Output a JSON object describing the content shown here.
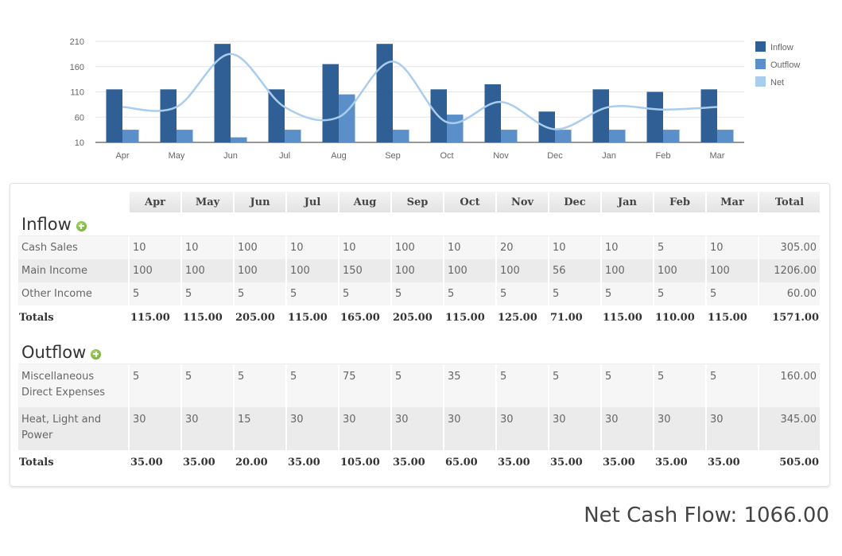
{
  "chart_data": {
    "type": "bar",
    "title": "",
    "xlabel": "",
    "ylabel": "",
    "categories": [
      "Apr",
      "May",
      "Jun",
      "Jul",
      "Aug",
      "Sep",
      "Oct",
      "Nov",
      "Dec",
      "Jan",
      "Feb",
      "Mar"
    ],
    "series": [
      {
        "name": "Inflow",
        "kind": "bar",
        "color": "#2f5f94",
        "values": [
          115,
          115,
          205,
          115,
          165,
          205,
          115,
          125,
          71,
          115,
          110,
          115
        ]
      },
      {
        "name": "Outflow",
        "kind": "bar",
        "color": "#5b8fc9",
        "values": [
          35,
          35,
          20,
          35,
          105,
          35,
          65,
          35,
          35,
          35,
          35,
          35
        ]
      },
      {
        "name": "Net",
        "kind": "line",
        "color": "#a9cdee",
        "values": [
          80,
          80,
          185,
          80,
          60,
          170,
          50,
          90,
          36,
          80,
          75,
          80
        ]
      }
    ],
    "yticks": [
      10,
      60,
      110,
      160,
      210
    ],
    "ylim": [
      10,
      210
    ],
    "grid": true,
    "legend": "top-right"
  },
  "table": {
    "months": [
      "Apr",
      "May",
      "Jun",
      "Jul",
      "Aug",
      "Sep",
      "Oct",
      "Nov",
      "Dec",
      "Jan",
      "Feb",
      "Mar"
    ],
    "total_header": "Total",
    "inflow": {
      "title": "Inflow",
      "add_icon": "plus-circle-icon",
      "rows": [
        {
          "label": "Cash Sales",
          "values": [
            "10",
            "10",
            "100",
            "10",
            "10",
            "100",
            "10",
            "20",
            "10",
            "10",
            "5",
            "10"
          ],
          "total": "305.00"
        },
        {
          "label": "Main Income",
          "values": [
            "100",
            "100",
            "100",
            "100",
            "150",
            "100",
            "100",
            "100",
            "56",
            "100",
            "100",
            "100"
          ],
          "total": "1206.00"
        },
        {
          "label": "Other Income",
          "values": [
            "5",
            "5",
            "5",
            "5",
            "5",
            "5",
            "5",
            "5",
            "5",
            "5",
            "5",
            "5"
          ],
          "total": "60.00"
        }
      ],
      "totals_label": "Totals",
      "totals": [
        "115.00",
        "115.00",
        "205.00",
        "115.00",
        "165.00",
        "205.00",
        "115.00",
        "125.00",
        "71.00",
        "115.00",
        "110.00",
        "115.00"
      ],
      "grand_total": "1571.00"
    },
    "outflow": {
      "title": "Outflow",
      "add_icon": "plus-circle-icon",
      "rows": [
        {
          "label": "Miscellaneous Direct Expenses",
          "values": [
            "5",
            "5",
            "5",
            "5",
            "75",
            "5",
            "35",
            "5",
            "5",
            "5",
            "5",
            "5"
          ],
          "total": "160.00"
        },
        {
          "label": "Heat, Light and Power",
          "values": [
            "30",
            "30",
            "15",
            "30",
            "30",
            "30",
            "30",
            "30",
            "30",
            "30",
            "30",
            "30"
          ],
          "total": "345.00"
        }
      ],
      "totals_label": "Totals",
      "totals": [
        "35.00",
        "35.00",
        "20.00",
        "35.00",
        "105.00",
        "35.00",
        "65.00",
        "35.00",
        "35.00",
        "35.00",
        "35.00",
        "35.00"
      ],
      "grand_total": "505.00"
    }
  },
  "summary": {
    "net_cash_flow_label": "Net Cash Flow:",
    "net_cash_flow_value": "1066.00"
  }
}
